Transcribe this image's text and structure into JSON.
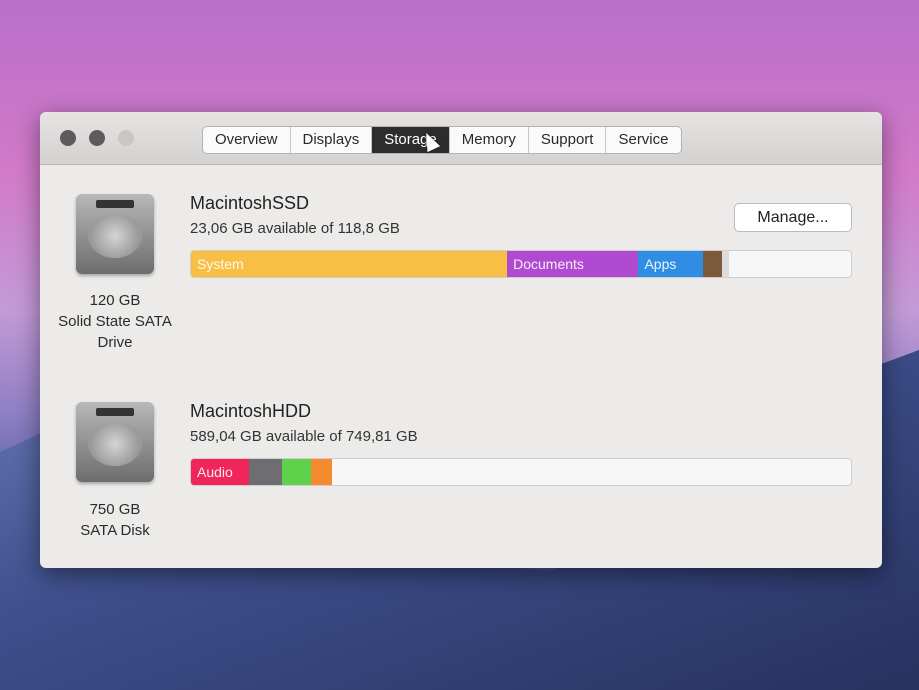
{
  "tabs": [
    "Overview",
    "Displays",
    "Storage",
    "Memory",
    "Support",
    "Service"
  ],
  "active_tab": "Storage",
  "manage_label": "Manage...",
  "disks": [
    {
      "name": "MacintoshSSD",
      "available": "23,06 GB available of 118,8 GB",
      "size": "120 GB",
      "type_line1": "Solid State SATA",
      "type_line2": "Drive",
      "segments": [
        {
          "label": "System",
          "pct": 47.9,
          "color": "#f8bf45"
        },
        {
          "label": "Documents",
          "pct": 19.9,
          "color": "#b04ad0"
        },
        {
          "label": "Apps",
          "pct": 9.8,
          "color": "#2f8ee4"
        },
        {
          "label": "",
          "pct": 2.9,
          "color": "#7a5a3a"
        },
        {
          "label": "",
          "pct": 1.0,
          "color": "#dcdcdc"
        }
      ]
    },
    {
      "name": "MacintoshHDD",
      "available": "589,04 GB available of 749,81 GB",
      "size": "750 GB",
      "type_line1": "SATA Disk",
      "type_line2": "",
      "segments": [
        {
          "label": "Audio",
          "pct": 8.8,
          "color": "#f0265a"
        },
        {
          "label": "",
          "pct": 5.0,
          "color": "#6e6d72"
        },
        {
          "label": "",
          "pct": 4.4,
          "color": "#5ed24a"
        },
        {
          "label": "",
          "pct": 3.2,
          "color": "#f58a2e"
        }
      ]
    }
  ]
}
